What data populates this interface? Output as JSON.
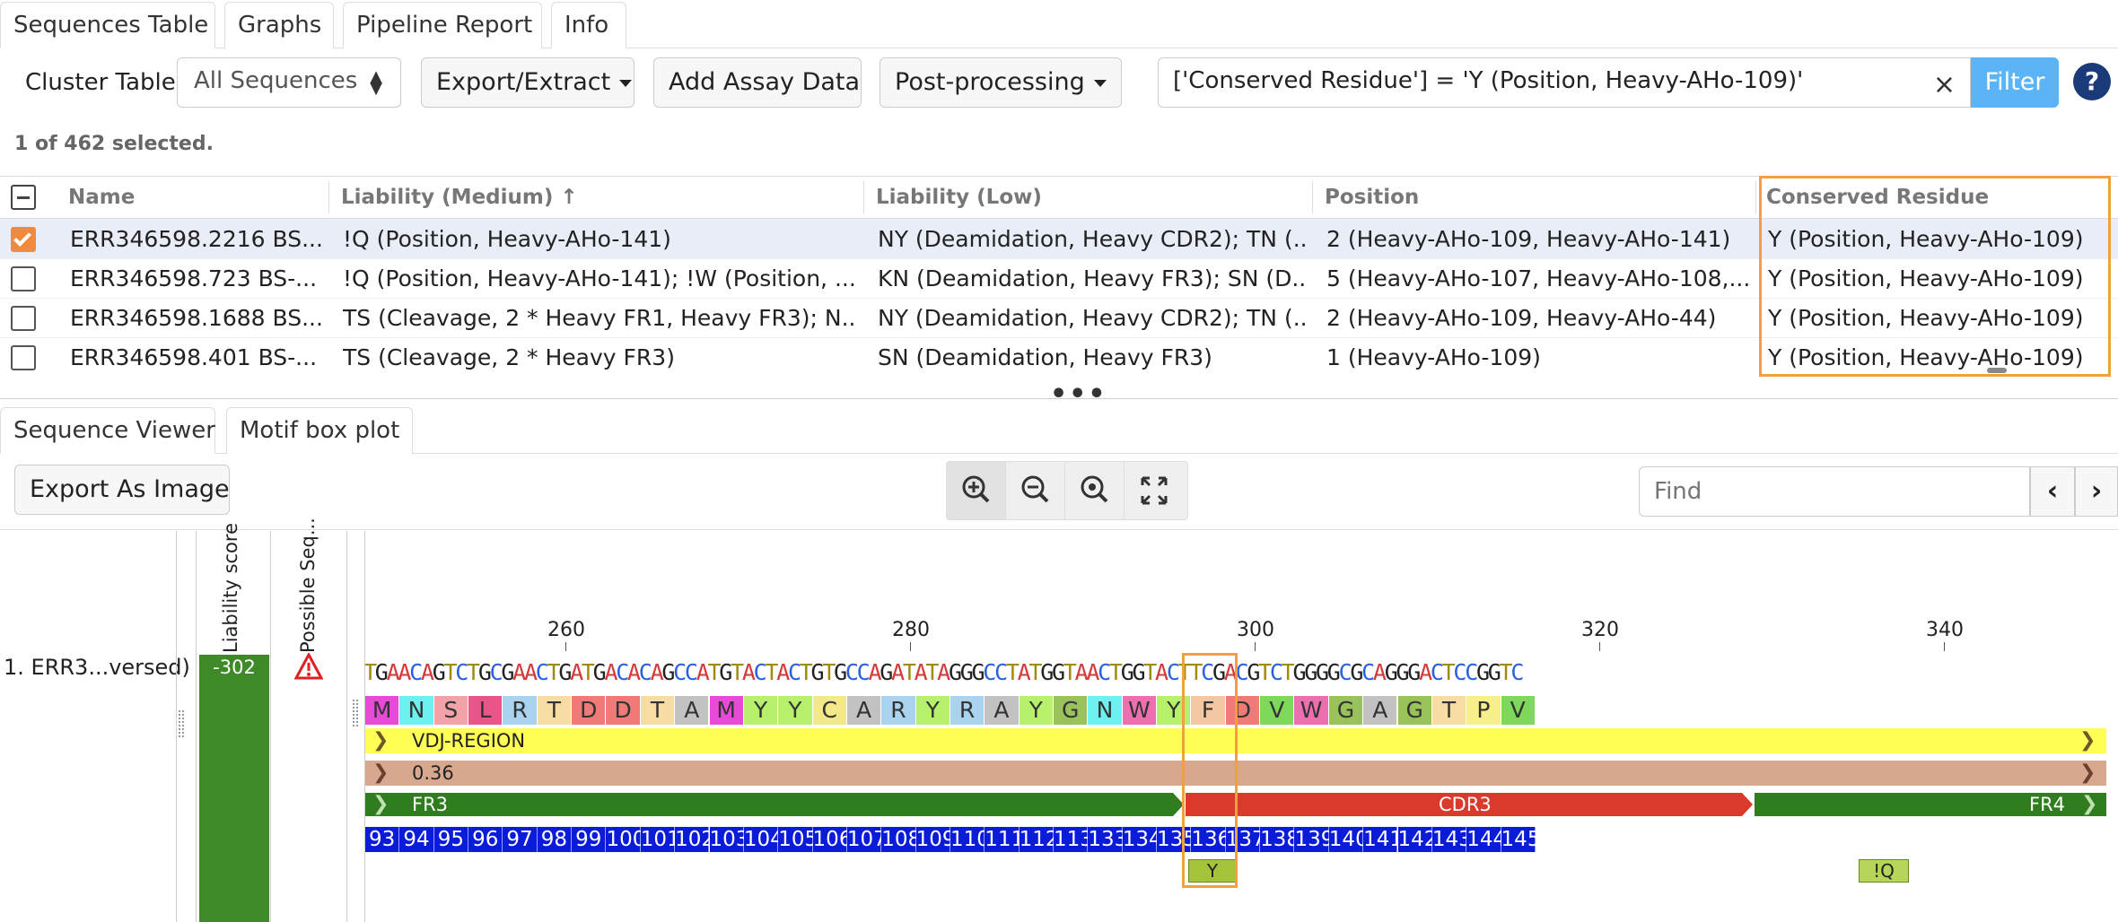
{
  "top_tabs": [
    "Sequences Table",
    "Graphs",
    "Pipeline Report",
    "Info"
  ],
  "toolbar": {
    "cluster_label": "Cluster Table:",
    "cluster_value": "All Sequences",
    "export_extract": "Export/Extract",
    "add_assay": "Add Assay Data",
    "post_processing": "Post-processing",
    "filter_query": "['Conserved Residue'] = 'Y (Position, Heavy-AHo-109)'",
    "filter_button": "Filter",
    "help": "?"
  },
  "selection_status": "1 of 462 selected.",
  "table": {
    "headers": [
      "Name",
      "Liability (Medium)",
      "Liability (Low)",
      "Position",
      "Conserved Residue"
    ],
    "sort_arrow": "↑",
    "rows": [
      {
        "name": "ERR346598.2216 BS...",
        "liability_medium": "!Q (Position, Heavy-AHo-141)",
        "liability_low": "NY (Deamidation, Heavy CDR2); TN (...",
        "position": "2 (Heavy-AHo-109, Heavy-AHo-141)",
        "conserved": "Y (Position, Heavy-AHo-109)",
        "selected": true
      },
      {
        "name": "ERR346598.723 BS-...",
        "liability_medium": "!Q (Position, Heavy-AHo-141); !W (Position, ...",
        "liability_low": "KN (Deamidation, Heavy FR3); SN (D...",
        "position": "5 (Heavy-AHo-107, Heavy-AHo-108,...",
        "conserved": "Y (Position, Heavy-AHo-109)",
        "selected": false
      },
      {
        "name": "ERR346598.1688 BS...",
        "liability_medium": "TS (Cleavage, 2 * Heavy FR1, Heavy FR3); N...",
        "liability_low": "NY (Deamidation, Heavy CDR2); TN (...",
        "position": "2 (Heavy-AHo-109, Heavy-AHo-44)",
        "conserved": "Y (Position, Heavy-AHo-109)",
        "selected": false
      },
      {
        "name": "ERR346598.401 BS-...",
        "liability_medium": "TS (Cleavage, 2 * Heavy FR3)",
        "liability_low": "SN (Deamidation, Heavy FR3)",
        "position": "1 (Heavy-AHo-109)",
        "conserved": "Y (Position, Heavy-AHo-109)",
        "selected": false
      }
    ]
  },
  "bottom_tabs": [
    "Sequence Viewer",
    "Motif box plot"
  ],
  "viewer": {
    "export_image": "Export As Image",
    "find_placeholder": "Find",
    "liability_score_header": "Liability score",
    "possible_seq_header": "Possible Seq...",
    "sequence_label": "1. ERR3...versed)",
    "liability_score_value": "-302",
    "ruler": [
      "260",
      "280",
      "300",
      "320",
      "340"
    ],
    "nucleotides": "TGAACAGTCTGCGAACTGATGACACAGCCATGTACTACTGTGCCAGATATAGGGCCTATGGTAACTGGTACTTCGACGTCTGGGGCGCAGGGACTCCGGTC",
    "residues": [
      {
        "aa": "M",
        "color": "#e84ad8"
      },
      {
        "aa": "N",
        "color": "#6df0f0"
      },
      {
        "aa": "S",
        "color": "#f2a3a9"
      },
      {
        "aa": "L",
        "color": "#e8558a"
      },
      {
        "aa": "R",
        "color": "#a9d3ee"
      },
      {
        "aa": "T",
        "color": "#f7dda3"
      },
      {
        "aa": "D",
        "color": "#f07a78"
      },
      {
        "aa": "D",
        "color": "#f07a78"
      },
      {
        "aa": "T",
        "color": "#f7dda3"
      },
      {
        "aa": "A",
        "color": "#c2c2c2"
      },
      {
        "aa": "M",
        "color": "#e84ad8"
      },
      {
        "aa": "Y",
        "color": "#b7f06a"
      },
      {
        "aa": "Y",
        "color": "#b7f06a"
      },
      {
        "aa": "C",
        "color": "#f4e98a"
      },
      {
        "aa": "A",
        "color": "#c2c2c2"
      },
      {
        "aa": "R",
        "color": "#a9d3ee"
      },
      {
        "aa": "Y",
        "color": "#b7f06a"
      },
      {
        "aa": "R",
        "color": "#a9d3ee"
      },
      {
        "aa": "A",
        "color": "#c2c2c2"
      },
      {
        "aa": "Y",
        "color": "#b7f06a"
      },
      {
        "aa": "G",
        "color": "#99c35a"
      },
      {
        "aa": "N",
        "color": "#6df0f0"
      },
      {
        "aa": "W",
        "color": "#ee6fb0"
      },
      {
        "aa": "Y",
        "color": "#b7f06a"
      },
      {
        "aa": "F",
        "color": "#f2c7a2"
      },
      {
        "aa": "D",
        "color": "#f07a78"
      },
      {
        "aa": "V",
        "color": "#7ed95b"
      },
      {
        "aa": "W",
        "color": "#ee6fb0"
      },
      {
        "aa": "G",
        "color": "#99c35a"
      },
      {
        "aa": "A",
        "color": "#c2c2c2"
      },
      {
        "aa": "G",
        "color": "#99c35a"
      },
      {
        "aa": "T",
        "color": "#f7dda3"
      },
      {
        "aa": "P",
        "color": "#f7f08a"
      },
      {
        "aa": "V",
        "color": "#7ed95b"
      }
    ],
    "annotations": {
      "vdj": "VDJ-REGION",
      "score": "0.36",
      "fr3": "FR3",
      "cdr3": "CDR3",
      "fr4": "FR4"
    },
    "numbering": [
      "93",
      "94",
      "95",
      "96",
      "97",
      "98",
      "99",
      "100",
      "101",
      "102",
      "103",
      "104",
      "105",
      "106",
      "107",
      "108",
      "109",
      "110",
      "111",
      "112",
      "113",
      "133",
      "134",
      "135",
      "136",
      "137",
      "138",
      "139",
      "140",
      "141",
      "142",
      "143",
      "144",
      "145"
    ],
    "markers": {
      "y": "Y",
      "q": "!Q"
    },
    "colors": {
      "accent": "#f08a3e",
      "filter": "#5bb4f5",
      "fr": "#2f7d1f",
      "cdr3": "#d93a2b",
      "vdj": "#ffff55",
      "score": "#d8a88e",
      "numbering": "#0a1cd8"
    }
  }
}
